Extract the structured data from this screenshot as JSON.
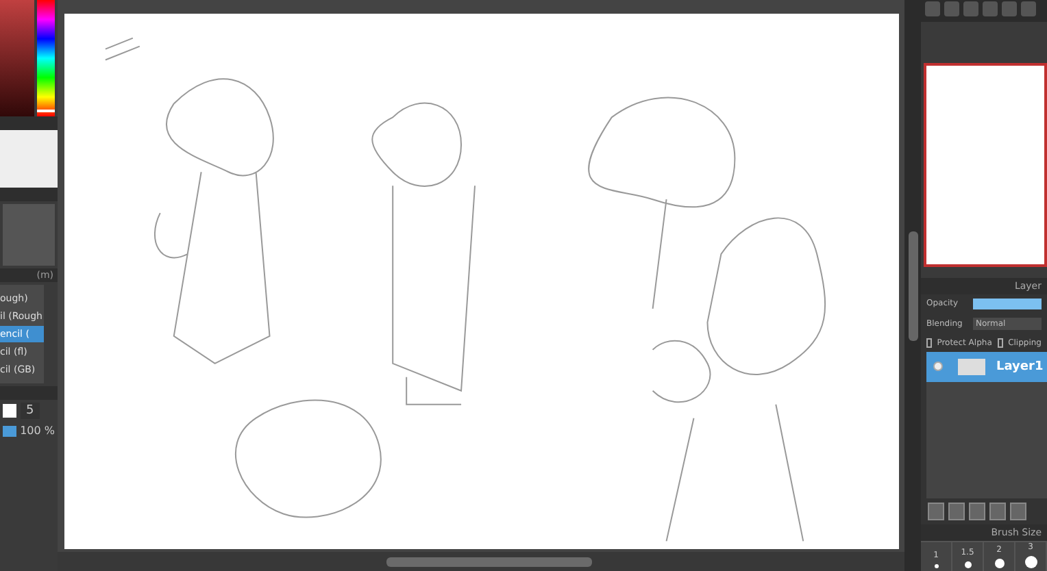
{
  "left_panel": {
    "brush_group_title": "(m)",
    "brushes": [
      {
        "label": "ough)",
        "selected": false
      },
      {
        "label": "il (Rough",
        "selected": false
      },
      {
        "label": "encil (",
        "selected": true
      },
      {
        "label": "cil (fl)",
        "selected": false
      },
      {
        "label": "cil (GB)",
        "selected": false
      }
    ],
    "brush_size": "5",
    "opacity": {
      "reading": "100 %",
      "level": 1
    },
    "hue": {
      "level": 0.97
    }
  },
  "layer_panel": {
    "title": "Layer",
    "opacity": {
      "label": "Opacity",
      "level": 1
    },
    "blending_label": "Blending",
    "blending_value": "Normal",
    "protect_alpha": {
      "label": "Protect Alpha",
      "checked": false
    },
    "clipping": {
      "label": "Clipping",
      "checked": false
    },
    "layers": [
      {
        "name": "Layer1",
        "visible": true,
        "selected": true
      }
    ]
  },
  "brush_size_panel": {
    "title": "Brush Size",
    "sizes": [
      "1",
      "1.5",
      "2",
      "3"
    ]
  }
}
